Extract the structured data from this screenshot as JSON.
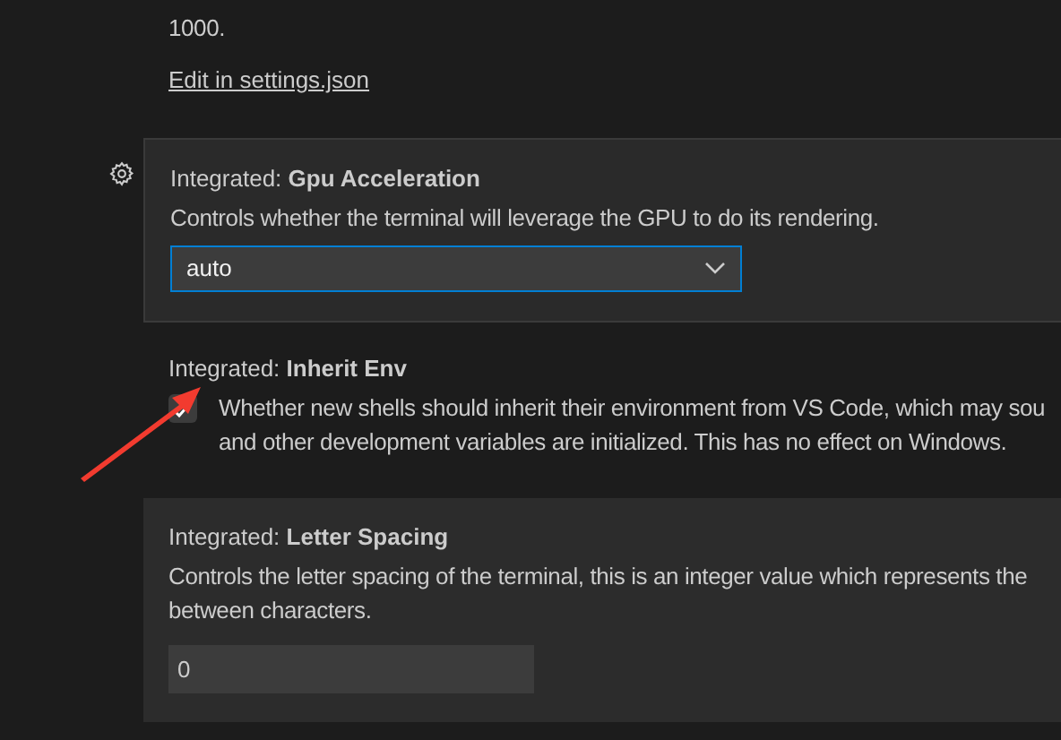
{
  "settings": [
    {
      "kind": "json",
      "focused": false,
      "hovered": false,
      "description": [
        "1000."
      ],
      "link": "Edit in settings.json"
    },
    {
      "kind": "dropdown",
      "focused": true,
      "hovered": false,
      "gear": true,
      "title": "Integrated: **Gpu Acceleration**",
      "description": [
        "Controls whether the terminal will leverage the GPU to do its rendering."
      ],
      "value": "auto"
    },
    {
      "kind": "checkbox",
      "focused": false,
      "hovered": false,
      "title": "Integrated: **Inherit Env**",
      "checked": true,
      "description": [
        "Whether new shells should inherit their environment from VS Code, which may sou",
        "and other development variables are initialized. This has no effect on Windows."
      ]
    },
    {
      "kind": "number",
      "focused": false,
      "hovered": true,
      "title": "Integrated: **Letter Spacing**",
      "description": [
        "Controls the letter spacing of the terminal, this is an integer value which represents the",
        "between characters."
      ],
      "value": "0"
    }
  ]
}
